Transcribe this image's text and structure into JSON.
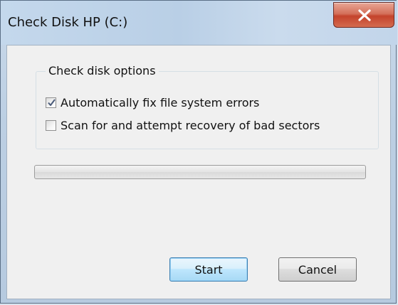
{
  "window": {
    "title": "Check Disk HP (C:)",
    "close_icon": "close-icon"
  },
  "options": {
    "group_title": "Check disk options",
    "items": [
      {
        "label": "Automatically fix file system errors",
        "checked": true
      },
      {
        "label": "Scan for and attempt recovery of bad sectors",
        "checked": false
      }
    ]
  },
  "progress": {
    "value": 0
  },
  "buttons": {
    "start_label": "Start",
    "cancel_label": "Cancel"
  },
  "colors": {
    "close_button": "#c4432c",
    "default_button_border": "#3c7fb1",
    "dialog_background": "#f0f0f0"
  }
}
